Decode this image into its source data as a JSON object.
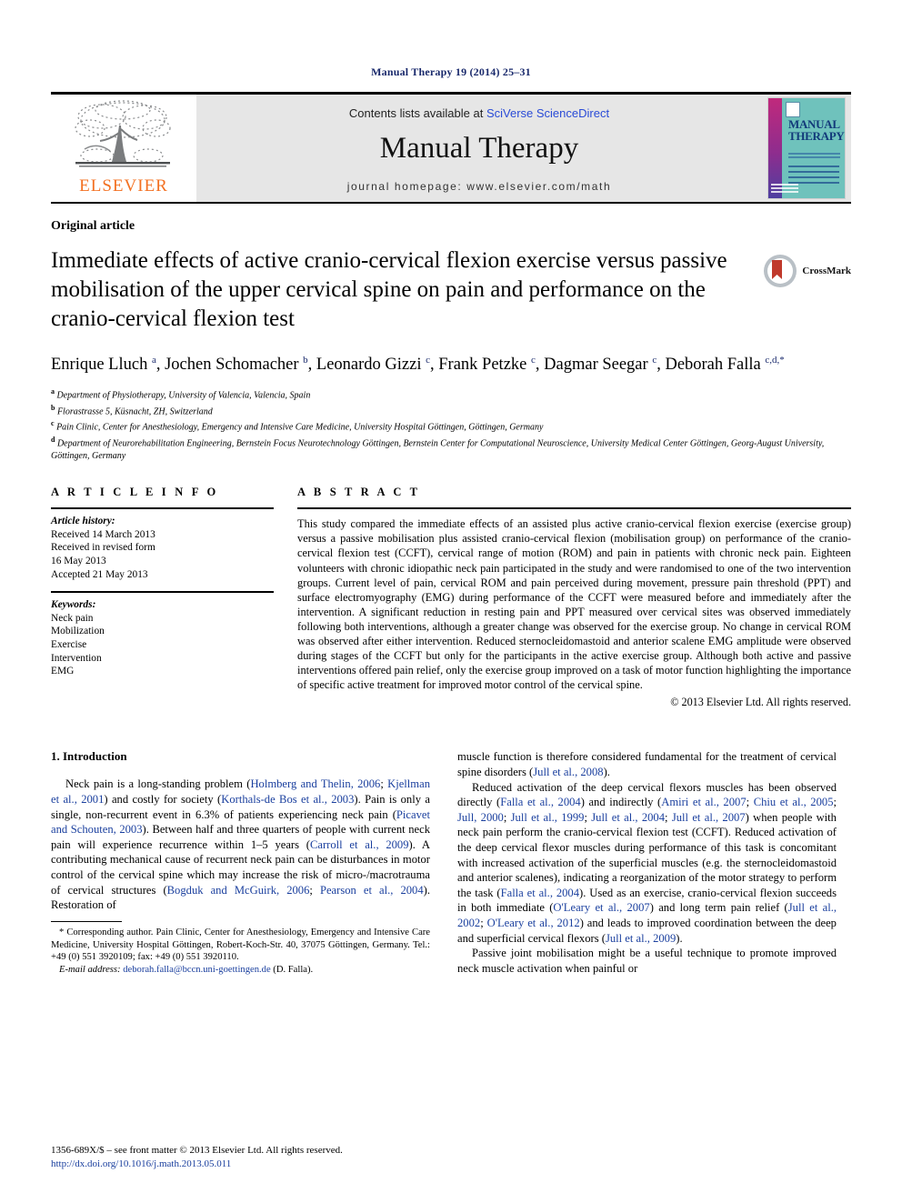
{
  "running_head": "Manual Therapy 19 (2014) 25–31",
  "masthead": {
    "publisher_wordmark": "ELSEVIER",
    "contents_prefix": "Contents lists available at ",
    "contents_link": "SciVerse ScienceDirect",
    "journal_title": "Manual Therapy",
    "homepage": "journal homepage: www.elsevier.com/math",
    "cover_title_line1": "MANUAL",
    "cover_title_line2": "THERAPY"
  },
  "article": {
    "type": "Original article",
    "title": "Immediate effects of active cranio-cervical flexion exercise versus passive mobilisation of the upper cervical spine on pain and performance on the cranio-cervical flexion test",
    "crossmark_label": "CrossMark",
    "authors": "Enrique Lluch <sup>a</sup>, Jochen Schomacher <sup>b</sup>, Leonardo Gizzi <sup>c</sup>, Frank Petzke <sup>c</sup>, Dagmar Seegar <sup>c</sup>, Deborah Falla <sup>c,d,</sup><sup>*</sup>",
    "affiliations": [
      "<sup>a</sup> Department of Physiotherapy, University of Valencia, Valencia, Spain",
      "<sup>b</sup> Florastrasse 5, Küsnacht, ZH, Switzerland",
      "<sup>c</sup> Pain Clinic, Center for Anesthesiology, Emergency and Intensive Care Medicine, University Hospital Göttingen, Göttingen, Germany",
      "<sup>d</sup> Department of Neurorehabilitation Engineering, Bernstein Focus Neurotechnology Göttingen, Bernstein Center for Computational Neuroscience, University Medical Center Göttingen, Georg-August University, Göttingen, Germany"
    ]
  },
  "article_info": {
    "heading": "A R T I C L E  I N F O",
    "history_label": "Article history:",
    "history": [
      "Received 14 March 2013",
      "Received in revised form",
      "16 May 2013",
      "Accepted 21 May 2013"
    ],
    "keywords_label": "Keywords:",
    "keywords": [
      "Neck pain",
      "Mobilization",
      "Exercise",
      "Intervention",
      "EMG"
    ]
  },
  "abstract": {
    "heading": "A B S T R A C T",
    "text": "This study compared the immediate effects of an assisted plus active cranio-cervical flexion exercise (exercise group) versus a passive mobilisation plus assisted cranio-cervical flexion (mobilisation group) on performance of the cranio-cervical flexion test (CCFT), cervical range of motion (ROM) and pain in patients with chronic neck pain. Eighteen volunteers with chronic idiopathic neck pain participated in the study and were randomised to one of the two intervention groups. Current level of pain, cervical ROM and pain perceived during movement, pressure pain threshold (PPT) and surface electromyography (EMG) during performance of the CCFT were measured before and immediately after the intervention. A significant reduction in resting pain and PPT measured over cervical sites was observed immediately following both interventions, although a greater change was observed for the exercise group. No change in cervical ROM was observed after either intervention. Reduced sternocleidomastoid and anterior scalene EMG amplitude were observed during stages of the CCFT but only for the participants in the active exercise group. Although both active and passive interventions offered pain relief, only the exercise group improved on a task of motor function highlighting the importance of specific active treatment for improved motor control of the cervical spine.",
    "copyright": "© 2013 Elsevier Ltd. All rights reserved."
  },
  "introduction": {
    "heading": "1. Introduction",
    "left_paragraphs": [
      "Neck pain is a long-standing problem (<span class=\"ref\">Holmberg and Thelin, 2006</span>; <span class=\"ref\">Kjellman et al., 2001</span>) and costly for society (<span class=\"ref\">Korthals-de Bos et al., 2003</span>). Pain is only a single, non-recurrent event in 6.3% of patients experiencing neck pain (<span class=\"ref\">Picavet and Schouten, 2003</span>). Between half and three quarters of people with current neck pain will experience recurrence within 1&ndash;5 years (<span class=\"ref\">Carroll et al., 2009</span>). A contributing mechanical cause of recurrent neck pain can be disturbances in motor control of the cervical spine which may increase the risk of micro-/macrotrauma of cervical structures (<span class=\"ref\">Bogduk and McGuirk, 2006</span>; <span class=\"ref\">Pearson et al., 2004</span>). Restoration of"
    ],
    "right_paragraphs": [
      "muscle function is therefore considered fundamental for the treatment of cervical spine disorders (<span class=\"ref\">Jull et al., 2008</span>).",
      "Reduced activation of the deep cervical flexors muscles has been observed directly (<span class=\"ref\">Falla et al., 2004</span>) and indirectly (<span class=\"ref\">Amiri et al., 2007</span>; <span class=\"ref\">Chiu et al., 2005</span>; <span class=\"ref\">Jull, 2000</span>; <span class=\"ref\">Jull et al., 1999</span>; <span class=\"ref\">Jull et al., 2004</span>; <span class=\"ref\">Jull et al., 2007</span>) when people with neck pain perform the cranio-cervical flexion test (CCFT). Reduced activation of the deep cervical flexor muscles during performance of this task is concomitant with increased activation of the superficial muscles (e.g. the sternocleidomastoid and anterior scalenes), indicating a reorganization of the motor strategy to perform the task (<span class=\"ref\">Falla et al., 2004</span>). Used as an exercise, cranio-cervical flexion succeeds in both immediate (<span class=\"ref\">O'Leary et al., 2007</span>) and long term pain relief (<span class=\"ref\">Jull et al., 2002</span>; <span class=\"ref\">O'Leary et al., 2012</span>) and leads to improved coordination between the deep and superficial cervical flexors (<span class=\"ref\">Jull et al., 2009</span>).",
      "Passive joint mobilisation might be a useful technique to promote improved neck muscle activation when painful or"
    ]
  },
  "footnote": {
    "corresponding": "* Corresponding author. Pain Clinic, Center for Anesthesiology, Emergency and Intensive Care Medicine, University Hospital Göttingen, Robert-Koch-Str. 40, 37075 Göttingen, Germany. Tel.: +49 (0) 551 3920109; fax: +49 (0) 551 3920110.",
    "email_label": "E-mail address:",
    "email": "deborah.falla@bccn.uni-goettingen.de",
    "email_suffix": " (D. Falla)."
  },
  "page_footer": {
    "front_matter": "1356-689X/$ – see front matter © 2013 Elsevier Ltd. All rights reserved.",
    "doi": "http://dx.doi.org/10.1016/j.math.2013.05.011"
  },
  "colors": {
    "link": "#2a4bd7",
    "reference": "#1a3f9e",
    "running_head": "#1a2a6c",
    "elsevier_orange": "#f37021",
    "cover_teal": "#6fc2bc",
    "cover_magenta": "#c0297c",
    "crossmark_red": "#c0392b"
  }
}
